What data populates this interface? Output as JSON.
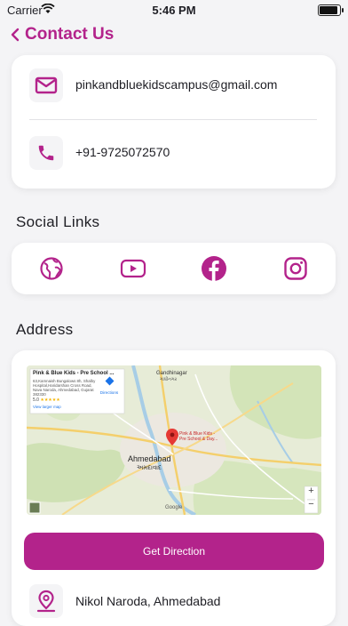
{
  "status_bar": {
    "carrier": "Carrier",
    "time": "5:46 PM"
  },
  "header": {
    "title": "Contact Us"
  },
  "contact": {
    "email": {
      "icon": "mail-icon",
      "value": "pinkandbluekidscampus@gmail.com"
    },
    "phone": {
      "icon": "phone-icon",
      "value": "+91-9725072570"
    }
  },
  "social": {
    "title": "Social Links",
    "items": [
      {
        "name": "website",
        "icon": "globe-icon"
      },
      {
        "name": "youtube",
        "icon": "youtube-icon"
      },
      {
        "name": "facebook",
        "icon": "facebook-icon"
      },
      {
        "name": "instagram",
        "icon": "instagram-icon"
      }
    ]
  },
  "address": {
    "title": "Address",
    "map": {
      "place_name": "Pink & Blue Kids - Pre School ...",
      "place_address_lines": [
        "63,Kamnaish Bungalows 8h, Shalby",
        "Hospital,Haridarshan Cross Road,",
        "Nava Naroda, Ahmedabad, Gujarat",
        "382330"
      ],
      "rating": "5.0",
      "stars": "★★★★★",
      "larger_map": "View larger map",
      "directions": "Directions",
      "marker_label_1": "Pink & Blue Kids -",
      "marker_label_2": "Pre School & Day...",
      "city_label": "Ahmedabad",
      "city_label_gu": "અમદાવાદ",
      "gandhinagar": "Gandhinagar",
      "gandhinagar_gu": "ગાંધીનગર",
      "google": "Google",
      "zoom_in": "+",
      "zoom_out": "−"
    },
    "direction_button": "Get Direction",
    "location": {
      "icon": "location-pin-icon",
      "value": "Nikol Naroda, Ahmedabad"
    }
  },
  "colors": {
    "accent": "#b3238b",
    "background": "#f4f4f6",
    "card": "#ffffff"
  }
}
